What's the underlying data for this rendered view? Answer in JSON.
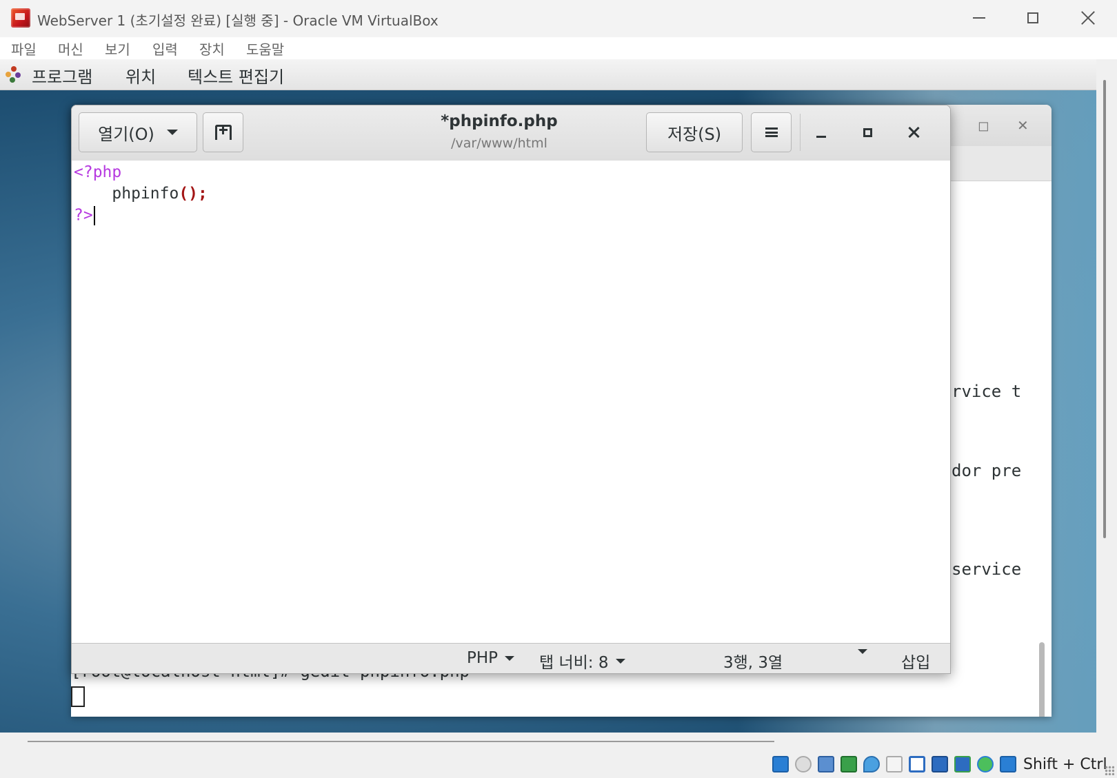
{
  "host": {
    "title": "WebServer 1 (초기설정 완료) [실행 중] - Oracle VM VirtualBox",
    "menu": [
      "파일",
      "머신",
      "보기",
      "입력",
      "장치",
      "도움말"
    ],
    "host_key": "Shift + Ctrl"
  },
  "gnome": {
    "items": [
      "프로그램",
      "위치",
      "텍스트 편집기"
    ]
  },
  "terminal": {
    "visible_lines": [
      "rvice t",
      "dor pre",
      "service"
    ],
    "command_line": "[root@localhost html]# gedit phpinfo.php"
  },
  "gedit": {
    "open_label": "열기(O)",
    "save_label": "저장(S)",
    "title": "*phpinfo.php",
    "subtitle": "/var/www/html",
    "code": {
      "line1": "<?php",
      "line2_fn": "phpinfo",
      "line2_parens": "();",
      "line3": "?>"
    },
    "status": {
      "language": "PHP",
      "tab_width": "탭 너비: 8",
      "position": "3행, 3열",
      "mode": "삽입"
    }
  },
  "colors": {
    "php_tag": "#b639e0",
    "punct": "#a31515"
  }
}
